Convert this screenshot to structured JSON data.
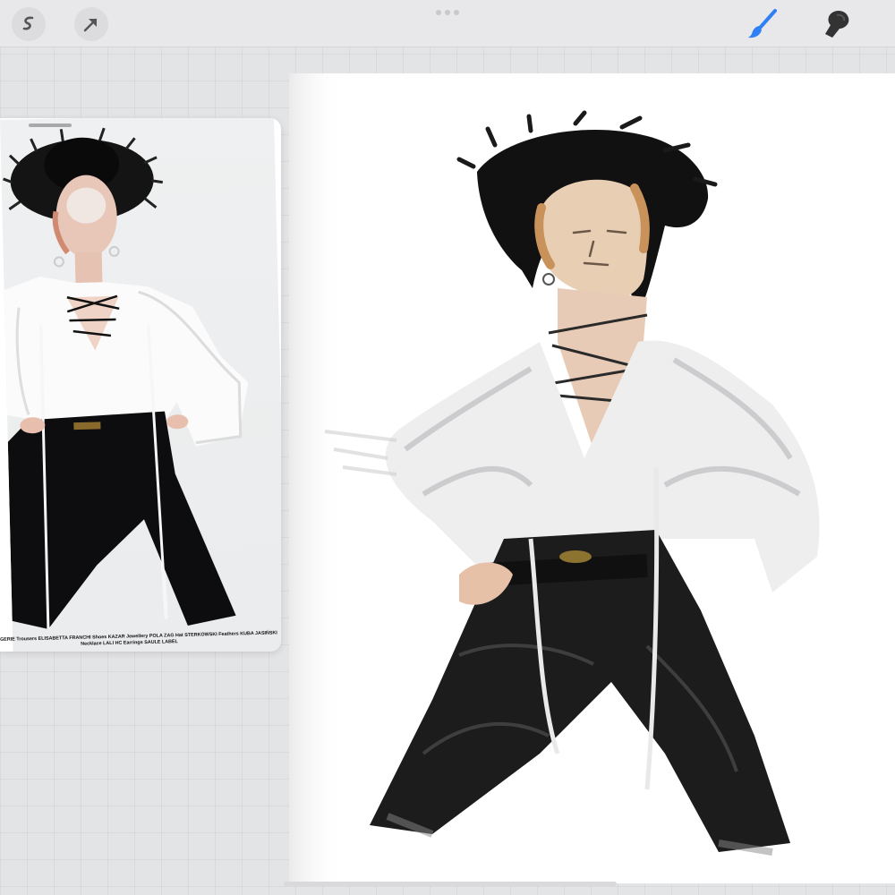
{
  "toolbar": {
    "left_tools": [
      {
        "name": "adjustments",
        "icon": "magic-wand-s-icon"
      },
      {
        "name": "selection",
        "icon": "arrow-cursor-icon"
      }
    ],
    "right_tools": [
      {
        "name": "brush",
        "icon": "brush-icon",
        "active": true,
        "color": "#2f7ff5"
      },
      {
        "name": "smudge",
        "icon": "finger-smudge-icon",
        "active": false,
        "color": "#333333"
      }
    ]
  },
  "reference": {
    "credits_line1": "GERIE Trousers ELISABETTA FRANCHI Shoes KAZAR Jewellery POLA ZAG Hat STERKOWSKI Feathers KUBA JASIŃSKI",
    "credits_line2": "Necklace LALI HC Earrings SAULE LABEL"
  },
  "colors": {
    "accent": "#2f7ff5",
    "canvas": "#ffffff",
    "workspace": "#e3e4e6"
  }
}
